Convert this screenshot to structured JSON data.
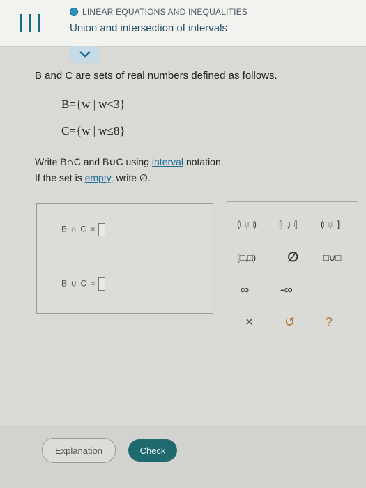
{
  "header": {
    "topic": "LINEAR EQUATIONS AND INEQUALITIES",
    "subtopic": "Union and intersection of intervals"
  },
  "question": {
    "prompt": "B and C are sets of real numbers defined as follows.",
    "setB": "B={w | w<3}",
    "setC": "C={w | w≤8}",
    "instruction_prefix": "Write B∩C and B∪C using",
    "instruction_link": "interval",
    "instruction_suffix": "notation.",
    "empty_prefix": "If the set is",
    "empty_link": "empty,",
    "empty_suffix": "write ∅."
  },
  "answers": {
    "intersection_label": "B ∩ C =",
    "union_label": "B ∪ C ="
  },
  "keypad": {
    "open_open": "(□,□)",
    "closed_closed": "[□,□]",
    "open_closed": "(□,□]",
    "closed_open": "[□,□)",
    "empty_set": "∅",
    "union": "□∪□",
    "infinity": "∞",
    "neg_infinity": "-∞",
    "clear": "×",
    "undo": "↺",
    "help": "?"
  },
  "buttons": {
    "explanation": "Explanation",
    "check": "Check"
  },
  "colors": {
    "accent": "#2f8fc0",
    "check_button": "#1f6a6f",
    "link": "#1f6e98"
  }
}
